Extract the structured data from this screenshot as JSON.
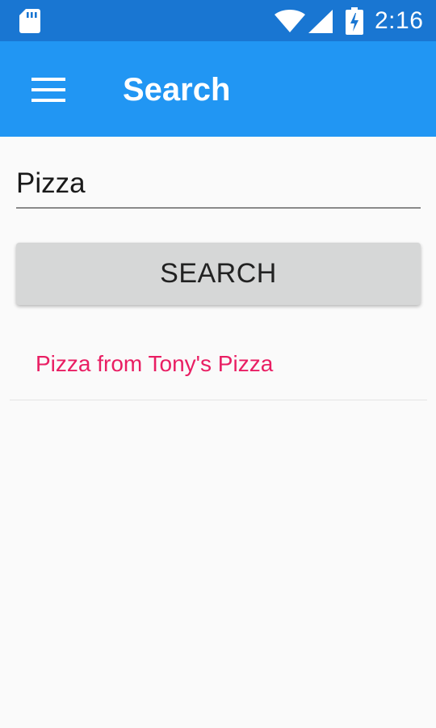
{
  "status_bar": {
    "time": "2:16",
    "icons": [
      "sd-card-icon",
      "wifi-icon",
      "cell-signal-icon",
      "battery-charging-icon"
    ],
    "background": "#1976d2"
  },
  "toolbar": {
    "title": "Search",
    "menu_icon": "hamburger-menu-icon",
    "background": "#2196f3"
  },
  "search": {
    "value": "Pizza",
    "button_label": "SEARCH"
  },
  "results": [
    {
      "label": "Pizza from Tony's Pizza",
      "color": "#e91e63"
    }
  ]
}
